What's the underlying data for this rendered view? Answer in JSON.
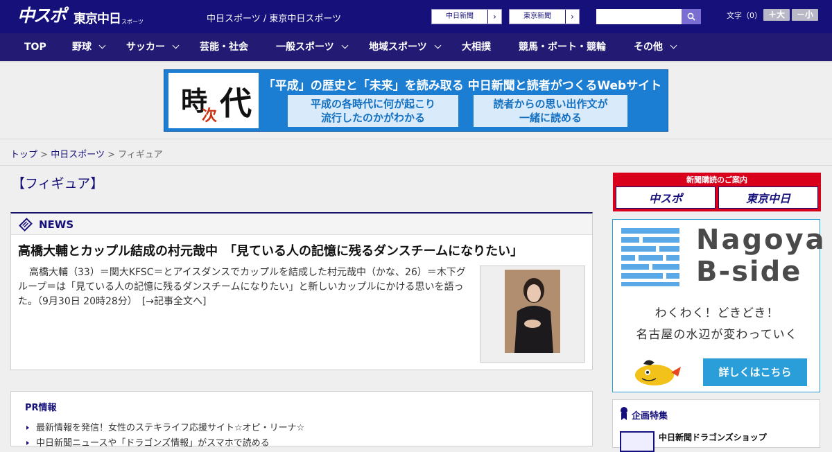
{
  "header": {
    "logo_main": "中スポ",
    "logo_tokyo": "東京中日",
    "logo_tokyo_small": "スポーツ",
    "site_links": "中日スポーツ / 東京中日スポーツ",
    "btn_chunichi": "中日新聞",
    "btn_tokyo": "東京新聞",
    "search_placeholder": "",
    "font_label": "文字（0）",
    "font_up": "＋大",
    "font_down": "－小"
  },
  "nav": [
    "TOP",
    "野球",
    "サッカー",
    "芸能・社会",
    "一般スポーツ",
    "地域スポーツ",
    "大相撲",
    "競馬・ボート・競輪",
    "その他"
  ],
  "banner": {
    "char1": "時",
    "char2": "次",
    "char3": "代",
    "headline": "「平成」の歴史と「未来」を読み取る  中日新聞と読者がつくるWebサイト",
    "box1_line1": "平成の各時代に何が起こり",
    "box1_line2": "流行したのかがわかる",
    "box2_line1": "読者からの思い出作文が",
    "box2_line2": "一緒に読める"
  },
  "breadcrumb": {
    "home": "トップ",
    "sep": ">",
    "section": "中日スポーツ",
    "current": "フィギュア"
  },
  "page_title": "【フィギュア】",
  "news": {
    "label": "NEWS",
    "headline": "高橋大輔とカップル結成の村元哉中　「見ている人の記憶に残るダンスチームになりたい」",
    "body": "高橋大輔（33）＝関大KFSC＝とアイスダンスでカップルを結成した村元哉中（かな、26）＝木下グループ＝は「見ている人の記憶に残るダンスチームになりたい」と新しいカップルにかける思いを語った。（9月30日 20時28分）　[→記事全文へ]"
  },
  "pr": {
    "title": "PR情報",
    "items": [
      "最新情報を発信！女性のステキライフ応援サイト☆オピ・リーナ☆",
      "中日新聞ニュースや「ドラゴンズ情報」がスマホで読める"
    ]
  },
  "sidebar": {
    "subscribe_title": "新聞購読のご案内",
    "subscribe_chuspo": "中スポ",
    "subscribe_tokyo": "東京中日",
    "bside_title1": "Nagoya",
    "bside_title2": "B-side",
    "bside_copy1": "わくわく！どきどき！",
    "bside_copy2": "名古屋の水辺が変わっていく",
    "bside_cta": "詳しくはこちら",
    "kikaku_label": "企画特集",
    "kikaku_item": "中日新聞ドラゴンズショップ"
  }
}
